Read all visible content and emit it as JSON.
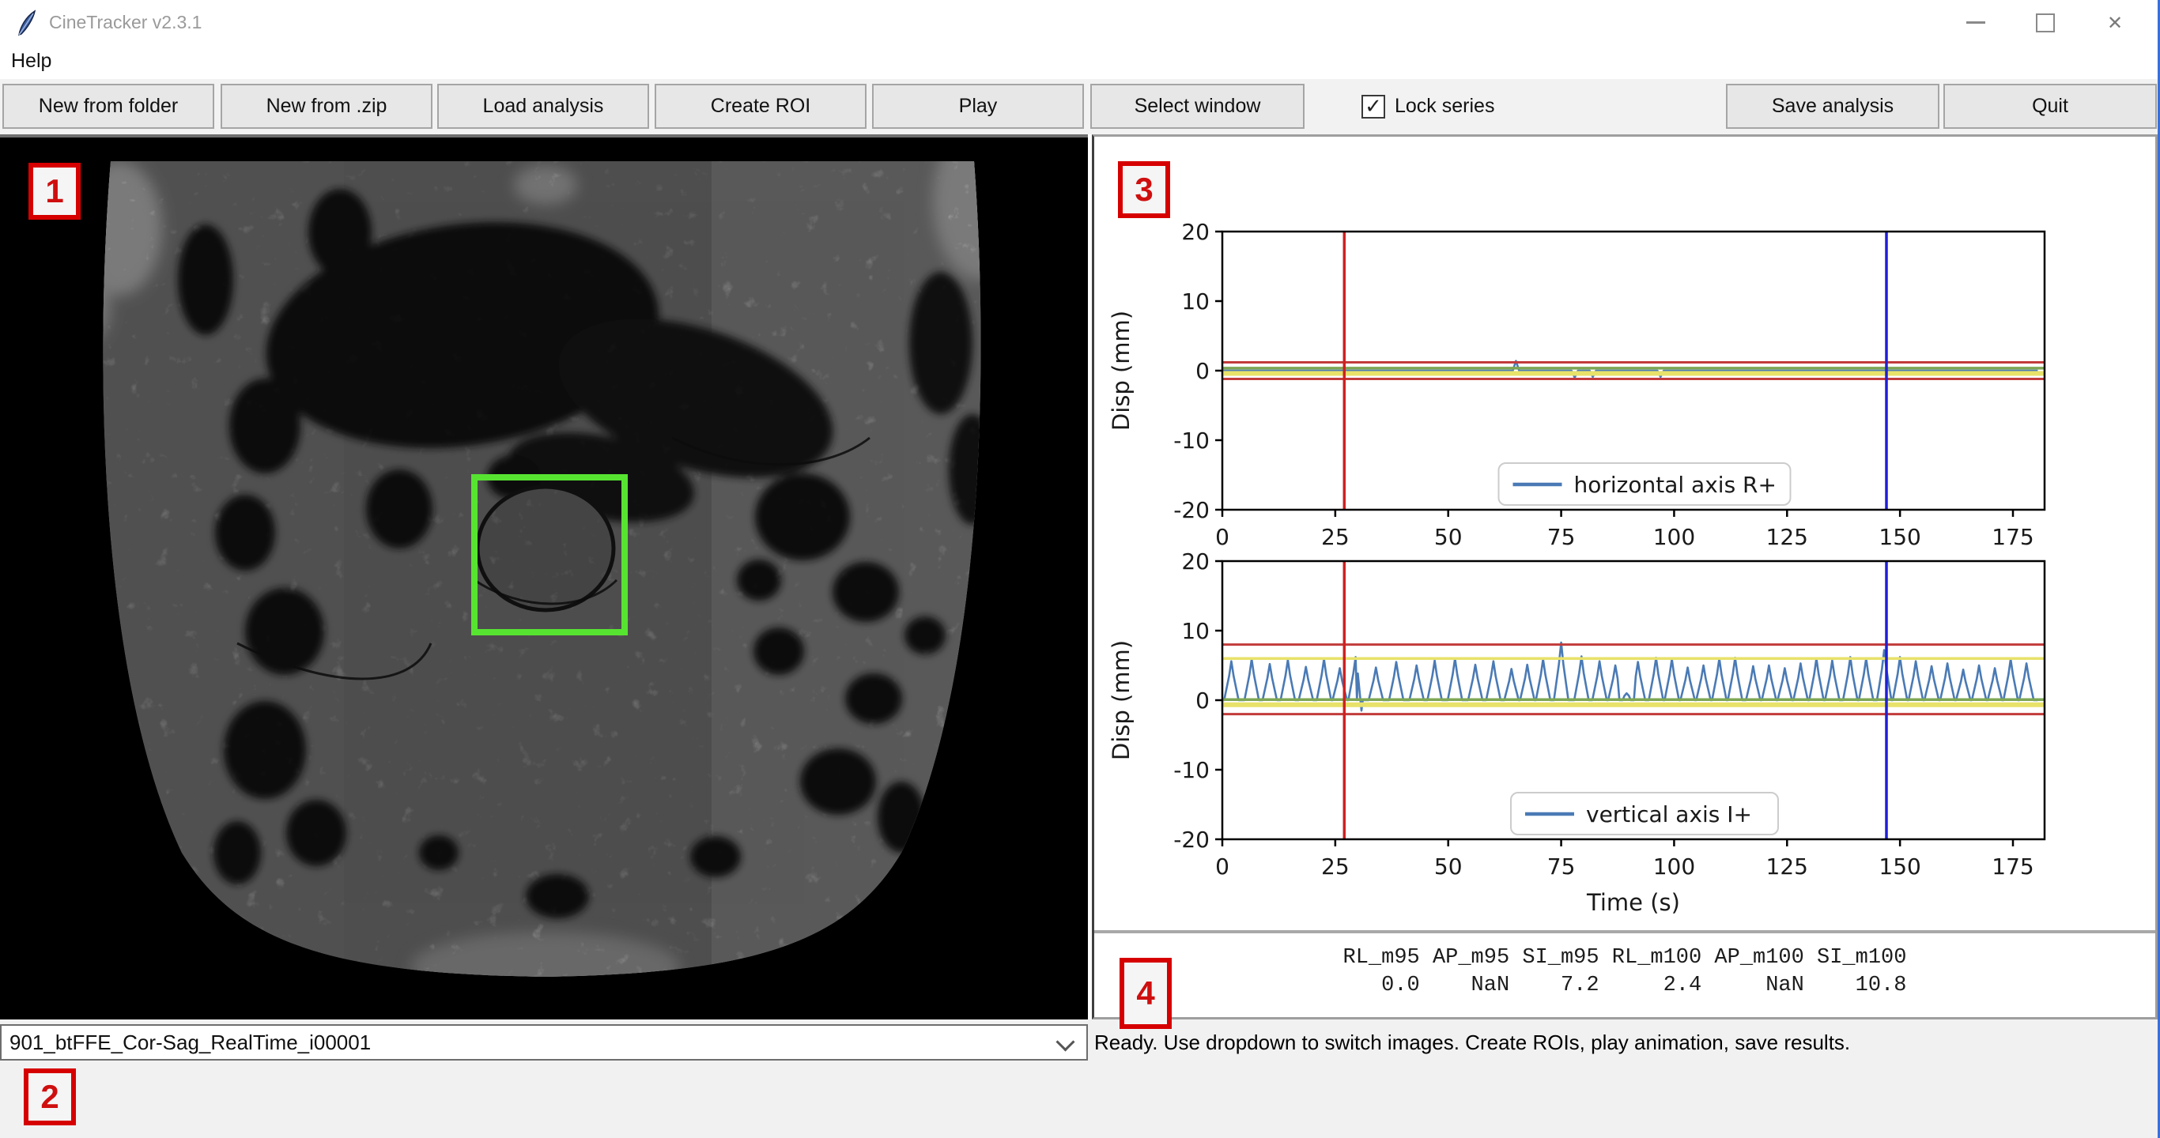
{
  "window": {
    "title": "CineTracker v2.3.1",
    "icon": "feather-icon",
    "controls": {
      "minimize": "minimize",
      "maximize": "maximize",
      "close": "✕"
    }
  },
  "menu": {
    "items": [
      {
        "label": "Help"
      }
    ]
  },
  "toolbar": {
    "buttons": [
      {
        "label": "New from folder"
      },
      {
        "label": "New from .zip"
      },
      {
        "label": "Load analysis"
      },
      {
        "label": "Create ROI"
      },
      {
        "label": "Play"
      },
      {
        "label": "Select window"
      },
      {
        "label": "Save analysis"
      },
      {
        "label": "Quit"
      }
    ],
    "lock_series": {
      "label": "Lock series",
      "checked": true,
      "checkmark": "✓"
    }
  },
  "annotations": {
    "color": "#d60000",
    "labels": [
      "1",
      "2",
      "3",
      "4"
    ]
  },
  "image_panel": {
    "roi_color": "#57e431",
    "modality": "MRI coronal-sagittal realtime frame"
  },
  "chart_data": [
    {
      "type": "line",
      "title": "",
      "xlabel": "",
      "ylabel": "Disp (mm)",
      "xlim": [
        0,
        182
      ],
      "ylim": [
        -20,
        20
      ],
      "xticks": [
        0,
        25,
        50,
        75,
        100,
        125,
        150,
        175
      ],
      "yticks": [
        -20,
        -10,
        0,
        10,
        20
      ],
      "grid": false,
      "legend": {
        "label": "horizontal axis R+",
        "position": "lower center"
      },
      "series_color": "#4a7ab5",
      "baseline": 0,
      "spikes": [
        {
          "t": 65,
          "v": 1.4
        },
        {
          "t": 78,
          "v": -1.0
        },
        {
          "t": 82,
          "v": -0.9
        },
        {
          "t": 97,
          "v": -0.9
        }
      ],
      "guides": [
        {
          "y": 1.2,
          "color": "#c23b3b",
          "w": 3
        },
        {
          "y": 0.35,
          "color": "#7da653",
          "w": 3.5
        },
        {
          "y": -0.4,
          "color": "#e8e26a",
          "w": 6
        },
        {
          "y": -1.2,
          "color": "#c23b3b",
          "w": 3
        }
      ],
      "vlines": [
        {
          "x": 27,
          "color": "#cf2020"
        },
        {
          "x": 147,
          "color": "#1f1fd8"
        }
      ]
    },
    {
      "type": "line",
      "title": "",
      "xlabel": "Time (s)",
      "ylabel": "Disp (mm)",
      "xlim": [
        0,
        182
      ],
      "ylim": [
        -20,
        20
      ],
      "xticks": [
        0,
        25,
        50,
        75,
        100,
        125,
        150,
        175
      ],
      "yticks": [
        -20,
        -10,
        0,
        10,
        20
      ],
      "grid": false,
      "legend": {
        "label": "vertical axis I+",
        "position": "lower center"
      },
      "series_color": "#4a7ab5",
      "baseline": 0,
      "peaks": [
        [
          2,
          5.6
        ],
        [
          6.5,
          5.9
        ],
        [
          10.5,
          5.2
        ],
        [
          14.5,
          5.8
        ],
        [
          18.5,
          4.8
        ],
        [
          22.5,
          5.9
        ],
        [
          26,
          4.6
        ],
        [
          29.5,
          6.2
        ],
        [
          34,
          4.7
        ],
        [
          38.5,
          5.5
        ],
        [
          43,
          5.0
        ],
        [
          47,
          5.7
        ],
        [
          51.5,
          6.0
        ],
        [
          56,
          5.1
        ],
        [
          60,
          5.6
        ],
        [
          64,
          4.5
        ],
        [
          67.5,
          5.1
        ],
        [
          71,
          5.9
        ],
        [
          75,
          8.3
        ],
        [
          79.5,
          6.3
        ],
        [
          83.5,
          5.6
        ],
        [
          87,
          5.0
        ],
        [
          89.5,
          1.0
        ],
        [
          92,
          5.5
        ],
        [
          96,
          6.1
        ],
        [
          99.5,
          5.9
        ],
        [
          103,
          4.7
        ],
        [
          106.5,
          5.0
        ],
        [
          110,
          6.0
        ],
        [
          113.5,
          6.1
        ],
        [
          117.5,
          4.9
        ],
        [
          121,
          5.0
        ],
        [
          124.5,
          4.6
        ],
        [
          128,
          5.3
        ],
        [
          131.5,
          6.0
        ],
        [
          135,
          5.7
        ],
        [
          139,
          6.2
        ],
        [
          142.5,
          6.0
        ],
        [
          146.5,
          7.2
        ],
        [
          150,
          6.2
        ],
        [
          153.5,
          5.6
        ],
        [
          157,
          4.9
        ],
        [
          160.5,
          5.3
        ],
        [
          164,
          4.4
        ],
        [
          167.5,
          5.0
        ],
        [
          171,
          4.6
        ],
        [
          174.5,
          5.9
        ],
        [
          178,
          5.3
        ]
      ],
      "dips": [
        [
          30.8,
          -1.5
        ]
      ],
      "guides": [
        {
          "y": 8,
          "color": "#c23b3b",
          "w": 3
        },
        {
          "y": 6,
          "color": "#e8e26a",
          "w": 3.5
        },
        {
          "y": 0.08,
          "color": "#7da653",
          "w": 3.5
        },
        {
          "y": -0.65,
          "color": "#e8e26a",
          "w": 6
        },
        {
          "y": -2,
          "color": "#c23b3b",
          "w": 3
        }
      ],
      "vlines": [
        {
          "x": 27,
          "color": "#cf2020"
        },
        {
          "x": 147,
          "color": "#1f1fd8"
        }
      ]
    }
  ],
  "stats": {
    "columns": [
      "RL_m95",
      "AP_m95",
      "SI_m95",
      "RL_m100",
      "AP_m100",
      "SI_m100"
    ],
    "values": [
      "0.0",
      "NaN",
      "7.2",
      "2.4",
      "NaN",
      "10.8"
    ],
    "header_line": "RL_m95 AP_m95 SI_m95 RL_m100 AP_m100 SI_m100",
    "values_line": "   0.0    NaN    7.2     2.4     NaN    10.8"
  },
  "bottom": {
    "dropdown_value": "901_btFFE_Cor-Sag_RealTime_i00001",
    "dropdown_icon": "chevron-down-icon",
    "status": "Ready. Use dropdown to switch images. Create ROIs, play animation, save results."
  },
  "colors": {
    "accent_red_line": "#cf2020",
    "accent_blue_line": "#1f1fd8",
    "guide_red": "#c23b3b",
    "guide_yellow": "#e8e26a",
    "guide_green": "#7da653",
    "series_blue": "#4a7ab5",
    "roi_green": "#57e431",
    "annotation_red": "#d60000"
  }
}
